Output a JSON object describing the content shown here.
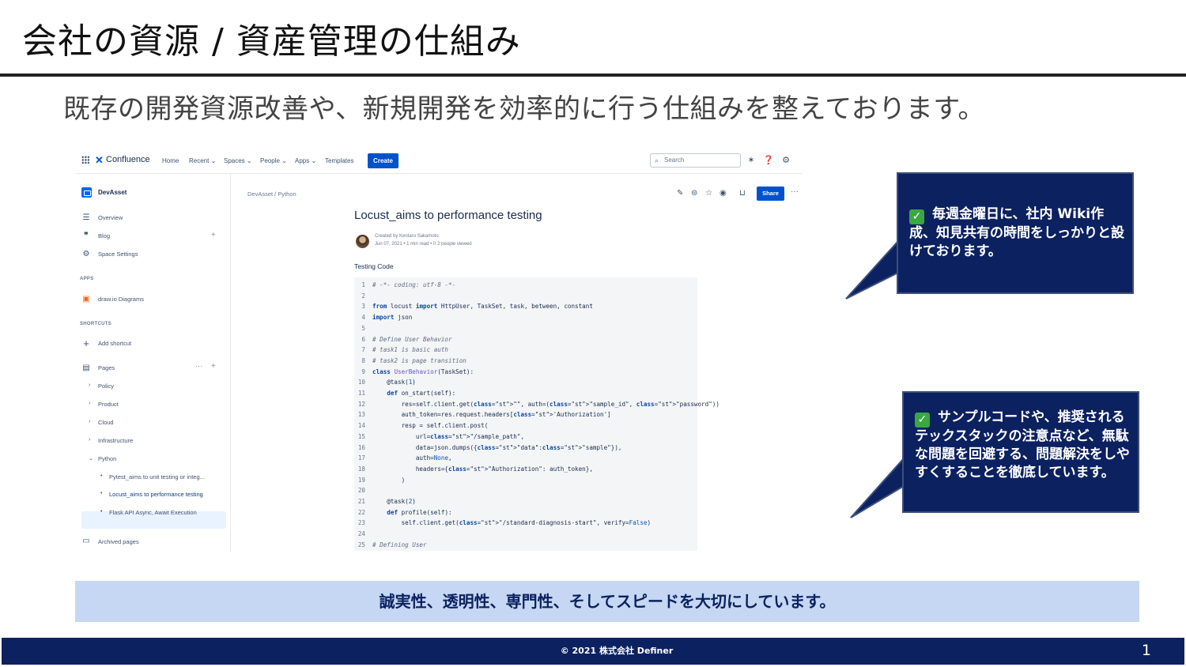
{
  "slide": {
    "title": "会社の資源 / 資産管理の仕組み",
    "subtitle": "既存の開発資源改善や、新規開発を効率的に行う仕組みを整えております。"
  },
  "confluence": {
    "nav": {
      "logo": "Confluence",
      "items": [
        "Home",
        "Recent ⌄",
        "Spaces ⌄",
        "People ⌄",
        "Apps ⌄",
        "Templates"
      ],
      "create": "Create",
      "search_placeholder": "Search"
    },
    "sidebar": {
      "space_name": "DevAsset",
      "overview": "Overview",
      "blog": "Blog",
      "space_settings": "Space Settings",
      "apps_heading": "APPS",
      "drawio": "draw.io Diagrams",
      "shortcuts_heading": "SHORTCUTS",
      "add_shortcut": "Add shortcut",
      "pages": "Pages",
      "tree": [
        "Policy",
        "Product",
        "Cloud",
        "Infrastructure",
        "Python"
      ],
      "children": [
        "Pytest_aims to unit testing or integ...",
        "Locust_aims to performance testing",
        "Flask API Async, Await Execution"
      ],
      "archived": "Archived pages"
    },
    "page": {
      "breadcrumb": "DevAsset  /  Python",
      "share": "Share",
      "title": "Locust_aims to performance testing",
      "created_by": "Created by Kentaro Sakamoto",
      "meta": "Jun 07, 2021 •  1 min read  •  ⌷ 2 people viewed",
      "section": "Testing Code"
    },
    "code": [
      "# -*- coding: utf-8 -*-",
      "",
      "from locust import HttpUser, TaskSet, task, between, constant",
      "import json",
      "",
      "# Define User Behavior",
      "# task1 is basic auth",
      "# task2 is page transition",
      "class UserBehavior(TaskSet):",
      "    @task(1)",
      "    def on_start(self):",
      "        res=self.client.get(\"\", auth=(\"sample_id\", \"password\"))",
      "        auth_token=res.request.headers['Authorization']",
      "        resp = self.client.post(",
      "            url=\"/sample_path\",",
      "            data=json.dumps({\"data\":\"sample\"}),",
      "            auth=None,",
      "            headers={\"Authorization\": auth_token},",
      "        )",
      "",
      "    @task(2)",
      "    def profile(self):",
      "        self.client.get(\"/standard-diagnosis-start\", verify=False)",
      "",
      "# Defining User"
    ]
  },
  "callouts": {
    "first": "毎週金曜日に、社内 Wiki作成、知見共有の時間をしっかりと設けております。",
    "second": "サンプルコードや、推奨されるテックスタックの注意点など、無駄な問題を回避する、問題解決をしやすくすることを徹底しています。"
  },
  "motto": "誠実性、透明性、専門性、そしてスピードを大切にしています。",
  "footer": {
    "copyright": "© 2021 株式会社 Definer",
    "page_number": "1"
  },
  "colors": {
    "navy": "#0b2160",
    "motto_bg": "#c5d7f2",
    "confluence_blue": "#0052cc",
    "check_green": "#3aa840"
  }
}
